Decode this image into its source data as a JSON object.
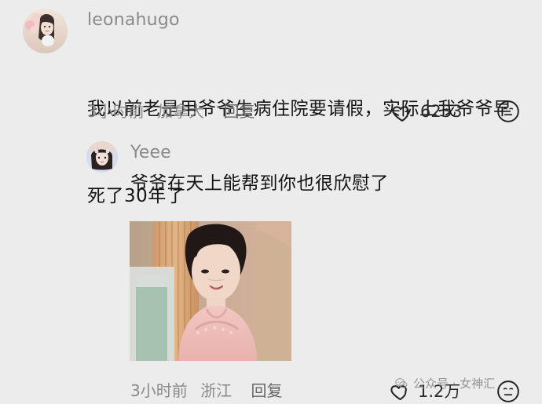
{
  "comments": [
    {
      "username": "leonahugo",
      "text_line_1": "我以前老是用爷爷生病住院要请假，实际上我爷爷早",
      "text_line_2": "死了30年了",
      "time": "3小时前",
      "location": "加拿大",
      "reply_label": "回复",
      "likes": "6233",
      "avatar_icon": "user-avatar-icon",
      "like_icon": "heart-outline-icon",
      "dislike_icon": "neutral-face-icon"
    },
    {
      "username": "Yeee",
      "text": "爷爷在天上能帮到你也很欣慰了",
      "time": "3小时前",
      "location": "浙江",
      "reply_label": "回复",
      "likes": "1.2万",
      "avatar_icon": "user-avatar-icon",
      "like_icon": "heart-outline-icon",
      "dislike_icon": "neutral-face-icon"
    }
  ],
  "watermark": {
    "text": "公众号 · 女神汇",
    "icon": "wechat-icon"
  },
  "colors": {
    "background": "#ececec",
    "username": "#8a8a8a",
    "text": "#141414",
    "meta": "#8a8a8a"
  }
}
